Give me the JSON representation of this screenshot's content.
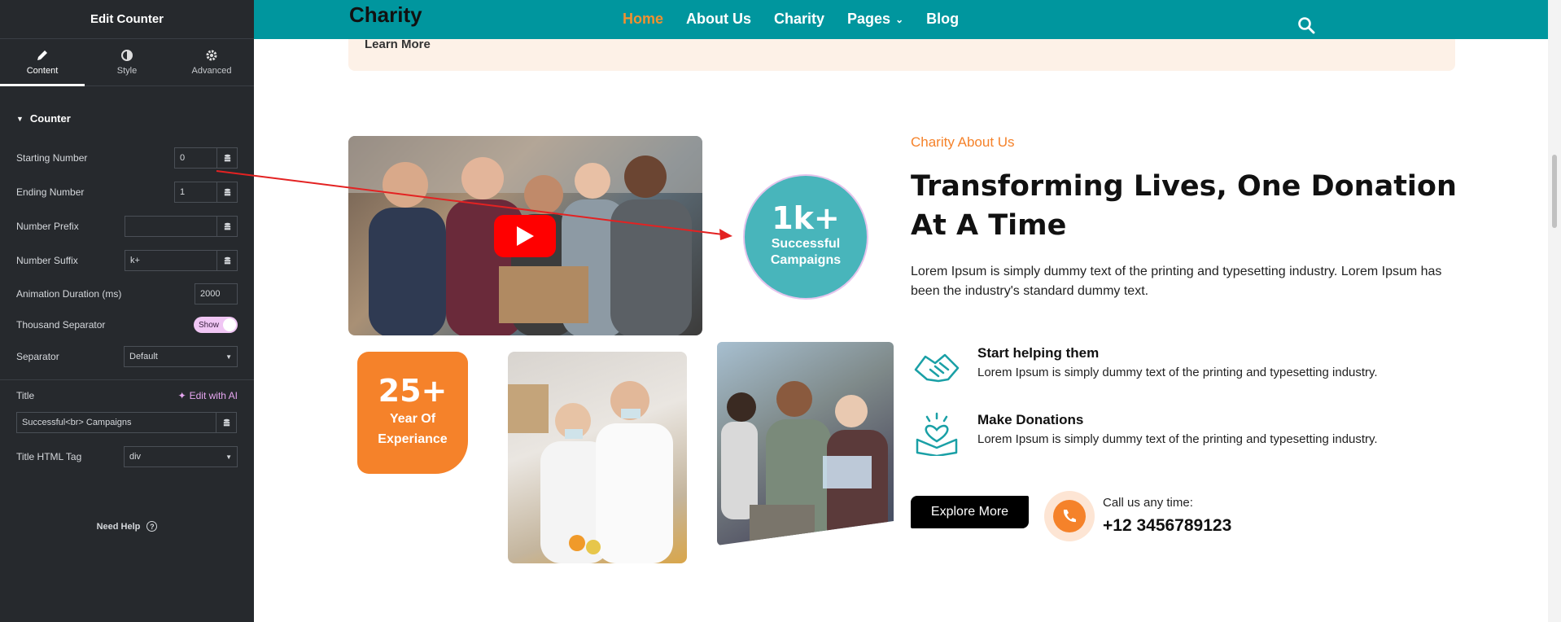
{
  "panel": {
    "title": "Edit Counter",
    "tabs": [
      {
        "label": "Content",
        "icon": "pencil-icon"
      },
      {
        "label": "Style",
        "icon": "contrast-icon"
      },
      {
        "label": "Advanced",
        "icon": "gear-icon"
      }
    ],
    "section": "Counter",
    "fields": {
      "starting_number": {
        "label": "Starting Number",
        "value": "0"
      },
      "ending_number": {
        "label": "Ending Number",
        "value": "1"
      },
      "number_prefix": {
        "label": "Number Prefix",
        "value": ""
      },
      "number_suffix": {
        "label": "Number Suffix",
        "value": "k+"
      },
      "animation_duration": {
        "label": "Animation Duration (ms)",
        "value": "2000"
      },
      "thousand_separator": {
        "label": "Thousand Separator",
        "value": "Show"
      },
      "separator": {
        "label": "Separator",
        "value": "Default"
      },
      "title": {
        "label": "Title",
        "value": "Successful<br> Campaigns",
        "ai_label": "Edit with AI"
      },
      "title_html_tag": {
        "label": "Title HTML Tag",
        "value": "div"
      }
    },
    "help": "Need Help"
  },
  "site": {
    "logo": "Charity",
    "nav": [
      {
        "label": "Home",
        "active": true
      },
      {
        "label": "About Us",
        "active": false
      },
      {
        "label": "Charity",
        "active": false
      },
      {
        "label": "Pages",
        "active": false
      },
      {
        "label": "Blog",
        "active": false
      }
    ],
    "banner_link": "Learn More",
    "counter": {
      "number": "1k+",
      "line1": "Successful",
      "line2": "Campaigns"
    },
    "experience": {
      "number": "25+",
      "line1": "Year Of",
      "line2": "Experiance"
    },
    "kicker": "Charity About Us",
    "heading": "Transforming Lives, One Donation At A Time",
    "paragraph": "Lorem Ipsum is simply dummy text of the printing and typesetting industry. Lorem Ipsum has been the industry's standard dummy text.",
    "features": [
      {
        "title": "Start helping them",
        "desc": "Lorem Ipsum is simply dummy text of the printing and typesetting industry.",
        "icon": "handshake-icon"
      },
      {
        "title": "Make Donations",
        "desc": "Lorem Ipsum is simply dummy text of the printing and typesetting industry.",
        "icon": "donation-box-icon"
      }
    ],
    "explore_label": "Explore More",
    "call_label": "Call us any time:",
    "call_number": "+12 3456789123"
  },
  "colors": {
    "accent": "#f5822a",
    "teal": "#00969e",
    "badge": "#48b5bb",
    "panel_bg": "#26292d"
  }
}
